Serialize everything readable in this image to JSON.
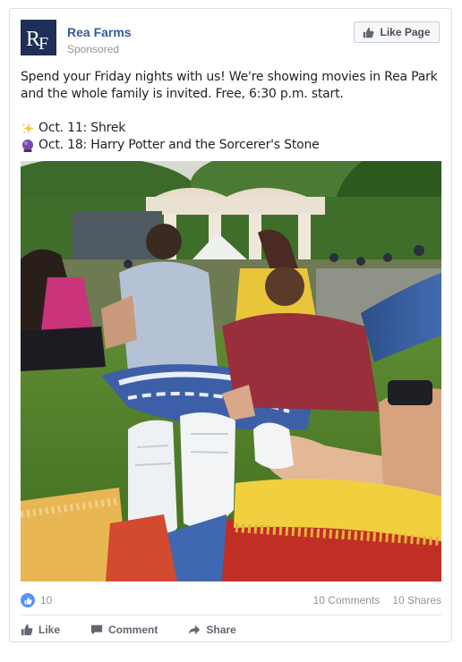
{
  "post": {
    "page_name": "Rea Farms",
    "logo_text": "RF",
    "sponsored": "Sponsored",
    "like_page_label": "Like Page",
    "text_intro": "Spend your Friday nights with us! We're showing movies in Rea Park and the whole family is invited. Free, 6:30 p.m. start.",
    "schedule": [
      {
        "icon": "sparkles-icon",
        "text": "Oct. 11: Shrek"
      },
      {
        "icon": "crystal-ball-icon",
        "text": "Oct. 18: Harry Potter and the Sorcerer's Stone"
      }
    ],
    "photo_alt": ""
  },
  "stats": {
    "likes": "10",
    "comments": "10 Comments",
    "shares": "10 Shares"
  },
  "actions": {
    "like": "Like",
    "comment": "Comment",
    "share": "Share"
  },
  "colors": {
    "link_blue": "#365899",
    "logo_navy": "#1f2f57",
    "like_blue": "#5890ff",
    "muted_gray": "#90949c"
  }
}
